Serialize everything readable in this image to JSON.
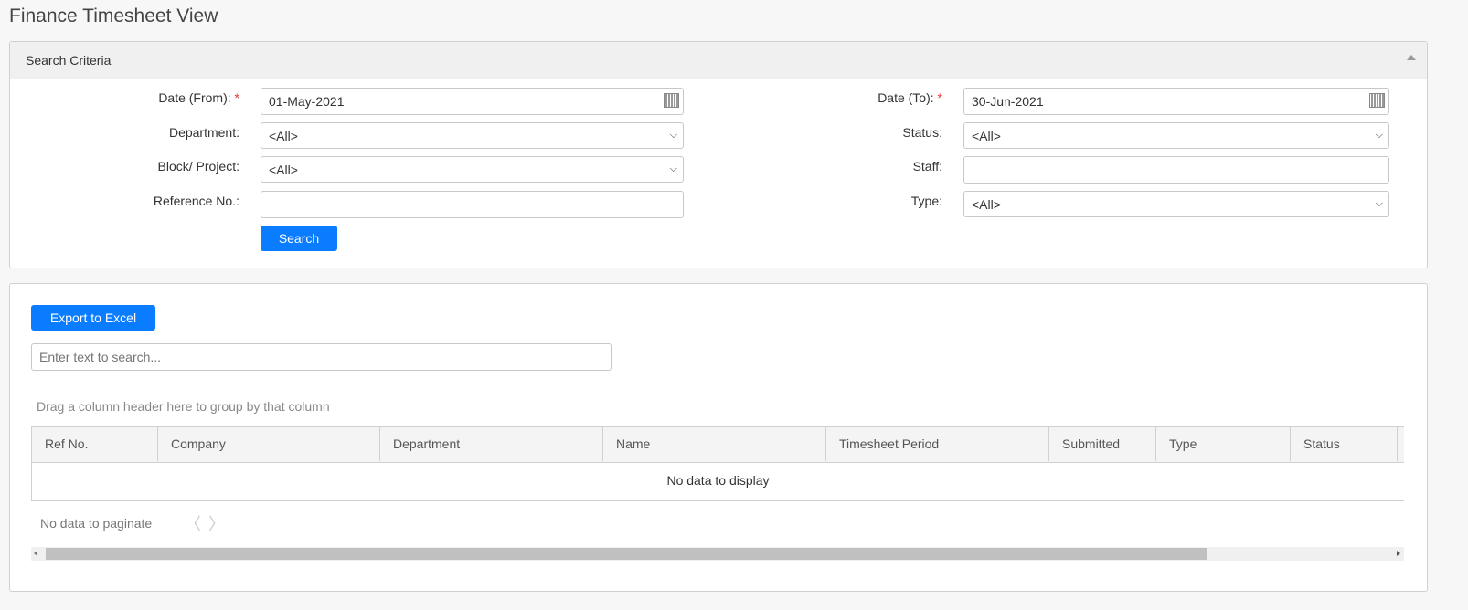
{
  "page_title": "Finance Timesheet View",
  "search_panel": {
    "header": "Search Criteria",
    "date_from": {
      "label": "Date (From):",
      "required": "*",
      "value": "01-May-2021"
    },
    "date_to": {
      "label": "Date (To):",
      "required": "*",
      "value": "30-Jun-2021"
    },
    "department": {
      "label": "Department:",
      "value": "<All>"
    },
    "status": {
      "label": "Status:",
      "value": "<All>"
    },
    "block_project": {
      "label": "Block/ Project:",
      "value": "<All>"
    },
    "staff": {
      "label": "Staff:",
      "value": ""
    },
    "reference_no": {
      "label": "Reference No.:",
      "value": ""
    },
    "type": {
      "label": "Type:",
      "value": "<All>"
    },
    "search_label": "Search"
  },
  "grid": {
    "export_label": "Export to Excel",
    "search_placeholder": "Enter text to search...",
    "group_hint": "Drag a column header here to group by that column",
    "columns": [
      "Ref No.",
      "Company",
      "Department",
      "Name",
      "Timesheet Period",
      "Submitted",
      "Type",
      "Status"
    ],
    "empty_text": "No data to display",
    "pager_text": "No data to paginate"
  },
  "colors": {
    "accent": "#0a7cff",
    "required": "#e33"
  }
}
